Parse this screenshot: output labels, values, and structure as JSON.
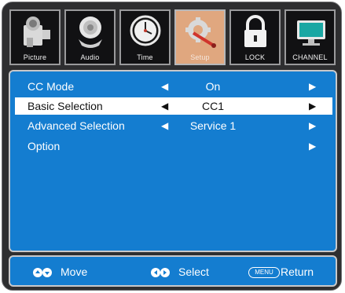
{
  "tabs": [
    {
      "label": "Picture",
      "icon": "camera-icon",
      "active": false
    },
    {
      "label": "Audio",
      "icon": "speaker-icon",
      "active": false
    },
    {
      "label": "Time",
      "icon": "clock-icon",
      "active": false
    },
    {
      "label": "Setup",
      "icon": "gear-tools-icon",
      "active": true
    },
    {
      "label": "LOCK",
      "icon": "padlock-icon",
      "active": false
    },
    {
      "label": "CHANNEL",
      "icon": "monitor-icon",
      "active": false
    }
  ],
  "menu": [
    {
      "name": "CC Mode",
      "value": "On",
      "selected": false,
      "left_arrow": "◀",
      "right_arrow": "▶"
    },
    {
      "name": "Basic Selection",
      "value": "CC1",
      "selected": true,
      "left_arrow": "◀",
      "right_arrow": "▶"
    },
    {
      "name": "Advanced Selection",
      "value": "Service 1",
      "selected": false,
      "left_arrow": "◀",
      "right_arrow": "▶"
    },
    {
      "name": "Option",
      "value": "",
      "selected": false,
      "left_arrow": "",
      "right_arrow": "▶"
    }
  ],
  "footer": {
    "move_label": "Move",
    "select_label": "Select",
    "menu_key": "MENU",
    "return_label": "Return"
  },
  "colors": {
    "panel_blue": "#147dd0",
    "frame_dark": "#2e2e30",
    "active_tab": "#e0a77f"
  }
}
